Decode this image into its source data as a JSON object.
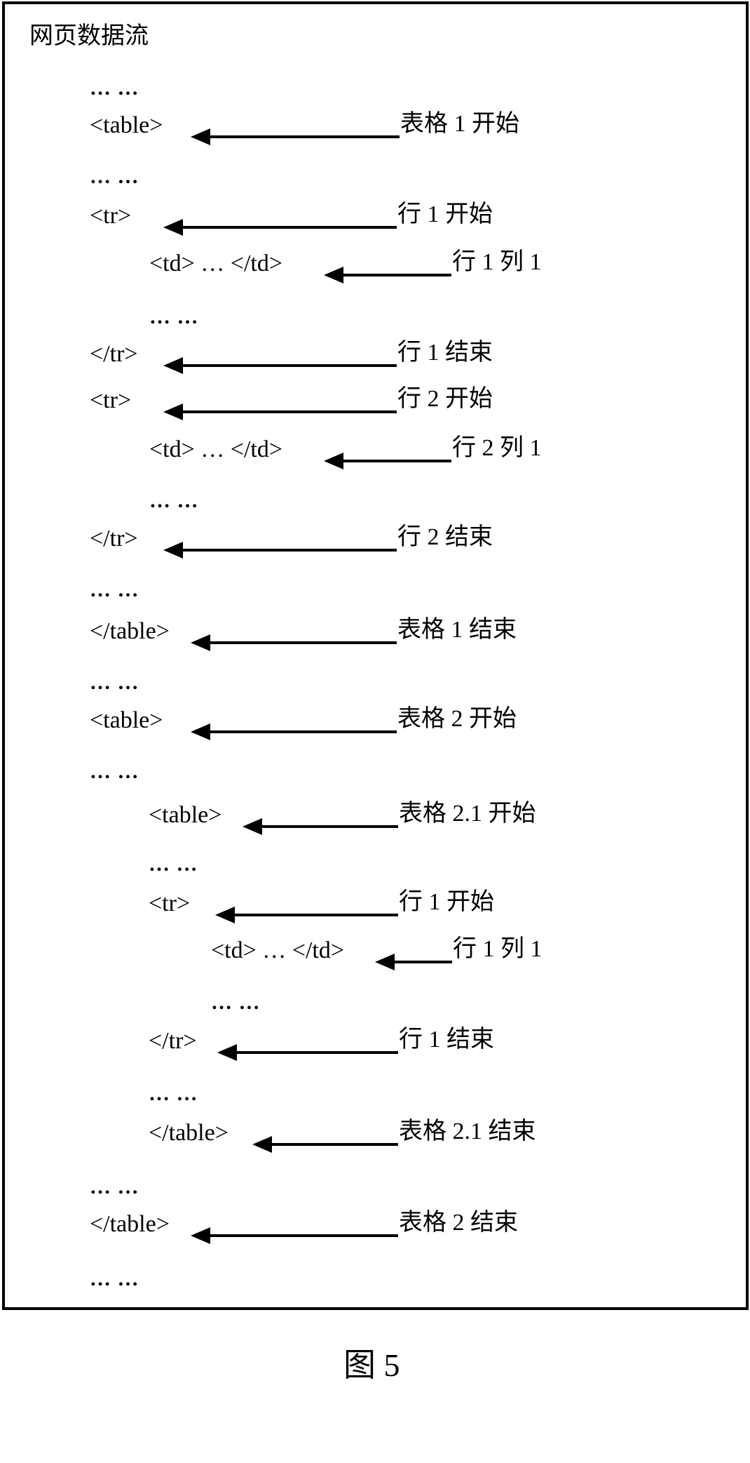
{
  "figure": {
    "title": "网页数据流",
    "caption": "图 5",
    "lines": [
      {
        "code": "… …",
        "label": null
      },
      {
        "code": "<table>",
        "label": "表格 1 开始"
      },
      {
        "code": "… …",
        "label": null
      },
      {
        "code": "<tr>",
        "label": "行 1 开始"
      },
      {
        "code": "<td> … </td>",
        "label": "行 1 列 1"
      },
      {
        "code": "… …",
        "label": null
      },
      {
        "code": "</tr>",
        "label": "行 1 结束"
      },
      {
        "code": "<tr>",
        "label": "行 2 开始"
      },
      {
        "code": "<td> … </td>",
        "label": "行 2 列 1"
      },
      {
        "code": "… …",
        "label": null
      },
      {
        "code": "</tr>",
        "label": "行 2 结束"
      },
      {
        "code": "… …",
        "label": null
      },
      {
        "code": "</table>",
        "label": "表格 1 结束"
      },
      {
        "code": "… …",
        "label": null
      },
      {
        "code": "<table>",
        "label": "表格 2 开始"
      },
      {
        "code": "… …",
        "label": null
      },
      {
        "code": "<table>",
        "label": "表格 2.1 开始"
      },
      {
        "code": "… …",
        "label": null
      },
      {
        "code": "<tr>",
        "label": "行 1 开始"
      },
      {
        "code": "<td> … </td>",
        "label": "行 1 列 1"
      },
      {
        "code": "… …",
        "label": null
      },
      {
        "code": "</tr>",
        "label": "行 1 结束"
      },
      {
        "code": "… …",
        "label": null
      },
      {
        "code": "</table>",
        "label": "表格 2.1 结束"
      },
      {
        "code": "… …",
        "label": null
      },
      {
        "code": "</table>",
        "label": "表格 2 结束"
      },
      {
        "code": "… …",
        "label": null
      }
    ]
  }
}
